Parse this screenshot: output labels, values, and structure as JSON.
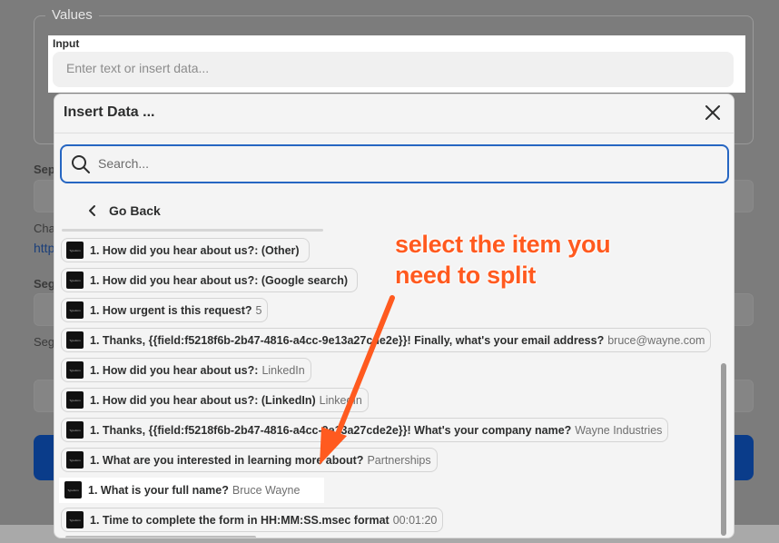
{
  "background": {
    "values_legend": "Values",
    "sep_label": "Sep",
    "cha_label": "Cha",
    "link_fragment": "http",
    "seg_label_1": "Seg",
    "seg_label_2": "Seg"
  },
  "input": {
    "label": "Input",
    "placeholder": "Enter text or insert data..."
  },
  "modal": {
    "title": "Insert Data ...",
    "search_placeholder": "Search...",
    "go_back": "Go Back",
    "items": [
      {
        "label": "1. How did you hear about us?: (Other)",
        "value": ""
      },
      {
        "label": "1. How did you hear about us?: (Google search)",
        "value": ""
      },
      {
        "label": "1. How urgent is this request?",
        "value": "5"
      },
      {
        "label": "1. Thanks, {{field:f5218f6b-2b47-4816-a4cc-9e13a27cde2e}}! Finally, what's your email address?",
        "value": "bruce@wayne.com"
      },
      {
        "label": "1. How did you hear about us?:",
        "value": "LinkedIn"
      },
      {
        "label": "1. How did you hear about us?: (LinkedIn)",
        "value": "LinkedIn"
      },
      {
        "label": "1. Thanks, {{field:f5218f6b-2b47-4816-a4cc-9e13a27cde2e}}! What's your company name?",
        "value": "Wayne Industries"
      },
      {
        "label": "1. What are you interested in learning more about?",
        "value": "Partnerships"
      },
      {
        "label": "1. What is your full name?",
        "value": "Bruce Wayne"
      },
      {
        "label": "1. Time to complete the form in HH:MM:SS.msec format",
        "value": "00:01:20"
      }
    ]
  },
  "annotation": {
    "text_line1": "select the item you",
    "text_line2": "need to split",
    "color": "#ff5a1f"
  },
  "colors": {
    "accent": "#2666c2",
    "primary_button": "#0a3c8a"
  }
}
